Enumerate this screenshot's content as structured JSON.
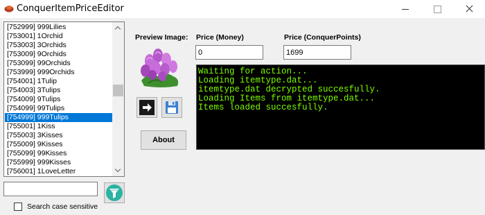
{
  "window": {
    "title": "ConquerItemPriceEditor"
  },
  "item_list": {
    "items": [
      "[752999] 999Lilies",
      "[753001] 1Orchid",
      "[753003] 3Orchids",
      "[753009] 9Orchids",
      "[753099] 99Orchids",
      "[753999] 999Orchids",
      "[754001] 1Tulip",
      "[754003] 3Tulips",
      "[754009] 9Tulips",
      "[754099] 99Tulips",
      "[754999] 999Tulips",
      "[755001] 1Kiss",
      "[755003] 3Kisses",
      "[755009] 9Kisses",
      "[755099] 99Kisses",
      "[755999] 999Kisses",
      "[756001] 1LoveLetter"
    ],
    "selected_index": 10
  },
  "search": {
    "value": "",
    "case_sensitive_label": "Search case sensitive",
    "case_sensitive_checked": false
  },
  "preview": {
    "label": "Preview Image:"
  },
  "price_money": {
    "label": "Price (Money)",
    "value": "0"
  },
  "price_cp": {
    "label": "Price (ConquerPoints)",
    "value": "1699"
  },
  "buttons": {
    "about_label": "About",
    "export_icon": "export-arrow-icon",
    "save_icon": "floppy-disk-icon",
    "filter_icon": "funnel-filter-icon"
  },
  "console": {
    "lines": [
      "Waiting for action...",
      "Loading itemtype.dat...",
      "itemtype.dat decrypted succesfully.",
      "Loading Items from itemtype.dat...",
      "Items loaded succesfully."
    ],
    "text_color": "#7cfc00",
    "background": "#000000"
  },
  "colors": {
    "selection": "#0078d7",
    "filter_button_accent": "#2bb3a3"
  }
}
